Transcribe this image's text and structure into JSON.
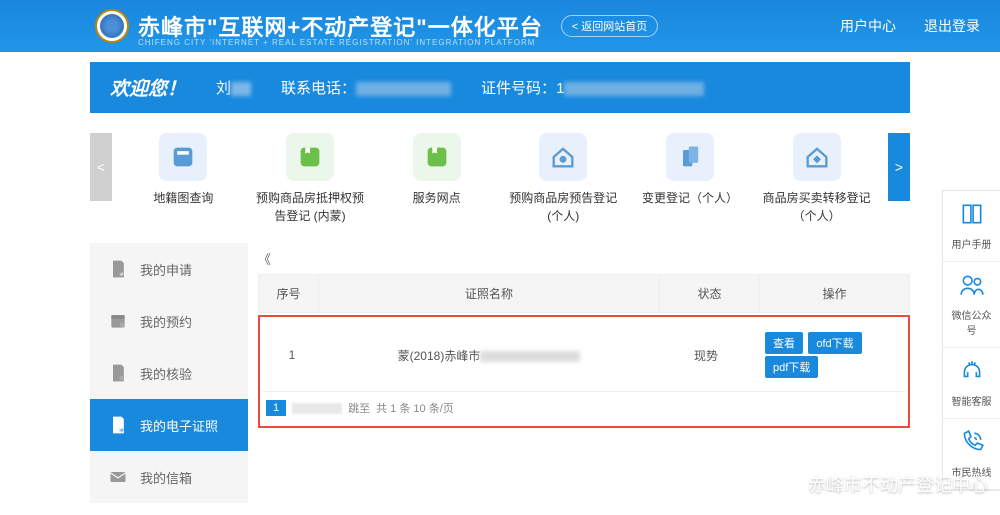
{
  "header": {
    "title": "赤峰市\"互联网+不动产登记\"一体化平台",
    "subtitle": "CHIFENG CITY 'INTERNET + REAL ESTATE REGISTRATION' INTEGRATION PLATFORM",
    "back_btn": "< 返回网站首页",
    "user_center": "用户中心",
    "logout": "退出登录"
  },
  "welcome": {
    "label": "欢迎您！",
    "name_prefix": "刘",
    "phone_label": "联系电话：",
    "id_label": "证件号码：",
    "id_prefix": "1"
  },
  "services": [
    {
      "label": "地籍图查询"
    },
    {
      "label": "预购商品房抵押权预告登记 (内蒙)"
    },
    {
      "label": "服务网点"
    },
    {
      "label": "预购商品房预告登记 (个人)"
    },
    {
      "label": "变更登记（个人）"
    },
    {
      "label": "商品房买卖转移登记（个人）"
    }
  ],
  "sidebar": [
    {
      "label": "我的申请"
    },
    {
      "label": "我的预约"
    },
    {
      "label": "我的核验"
    },
    {
      "label": "我的电子证照"
    },
    {
      "label": "我的信箱"
    }
  ],
  "table": {
    "headers": {
      "seq": "序号",
      "name": "证照名称",
      "status": "状态",
      "action": "操作"
    },
    "row": {
      "seq": "1",
      "name_prefix": "蒙(2018)赤峰市",
      "status": "现势"
    },
    "buttons": {
      "view": "查看",
      "ofd": "ofd下载",
      "pdf": "pdf下载"
    },
    "pager": {
      "info": "共 1 条   10 条/页",
      "page": "1",
      "sep": "跳至",
      "page_word": "页"
    }
  },
  "right_panel": [
    {
      "label": "用户手册"
    },
    {
      "label": "微信公众号"
    },
    {
      "label": "智能客服"
    },
    {
      "label": "市民热线"
    }
  ],
  "wechat": "赤峰市不动产登记中心",
  "collapse": "《"
}
